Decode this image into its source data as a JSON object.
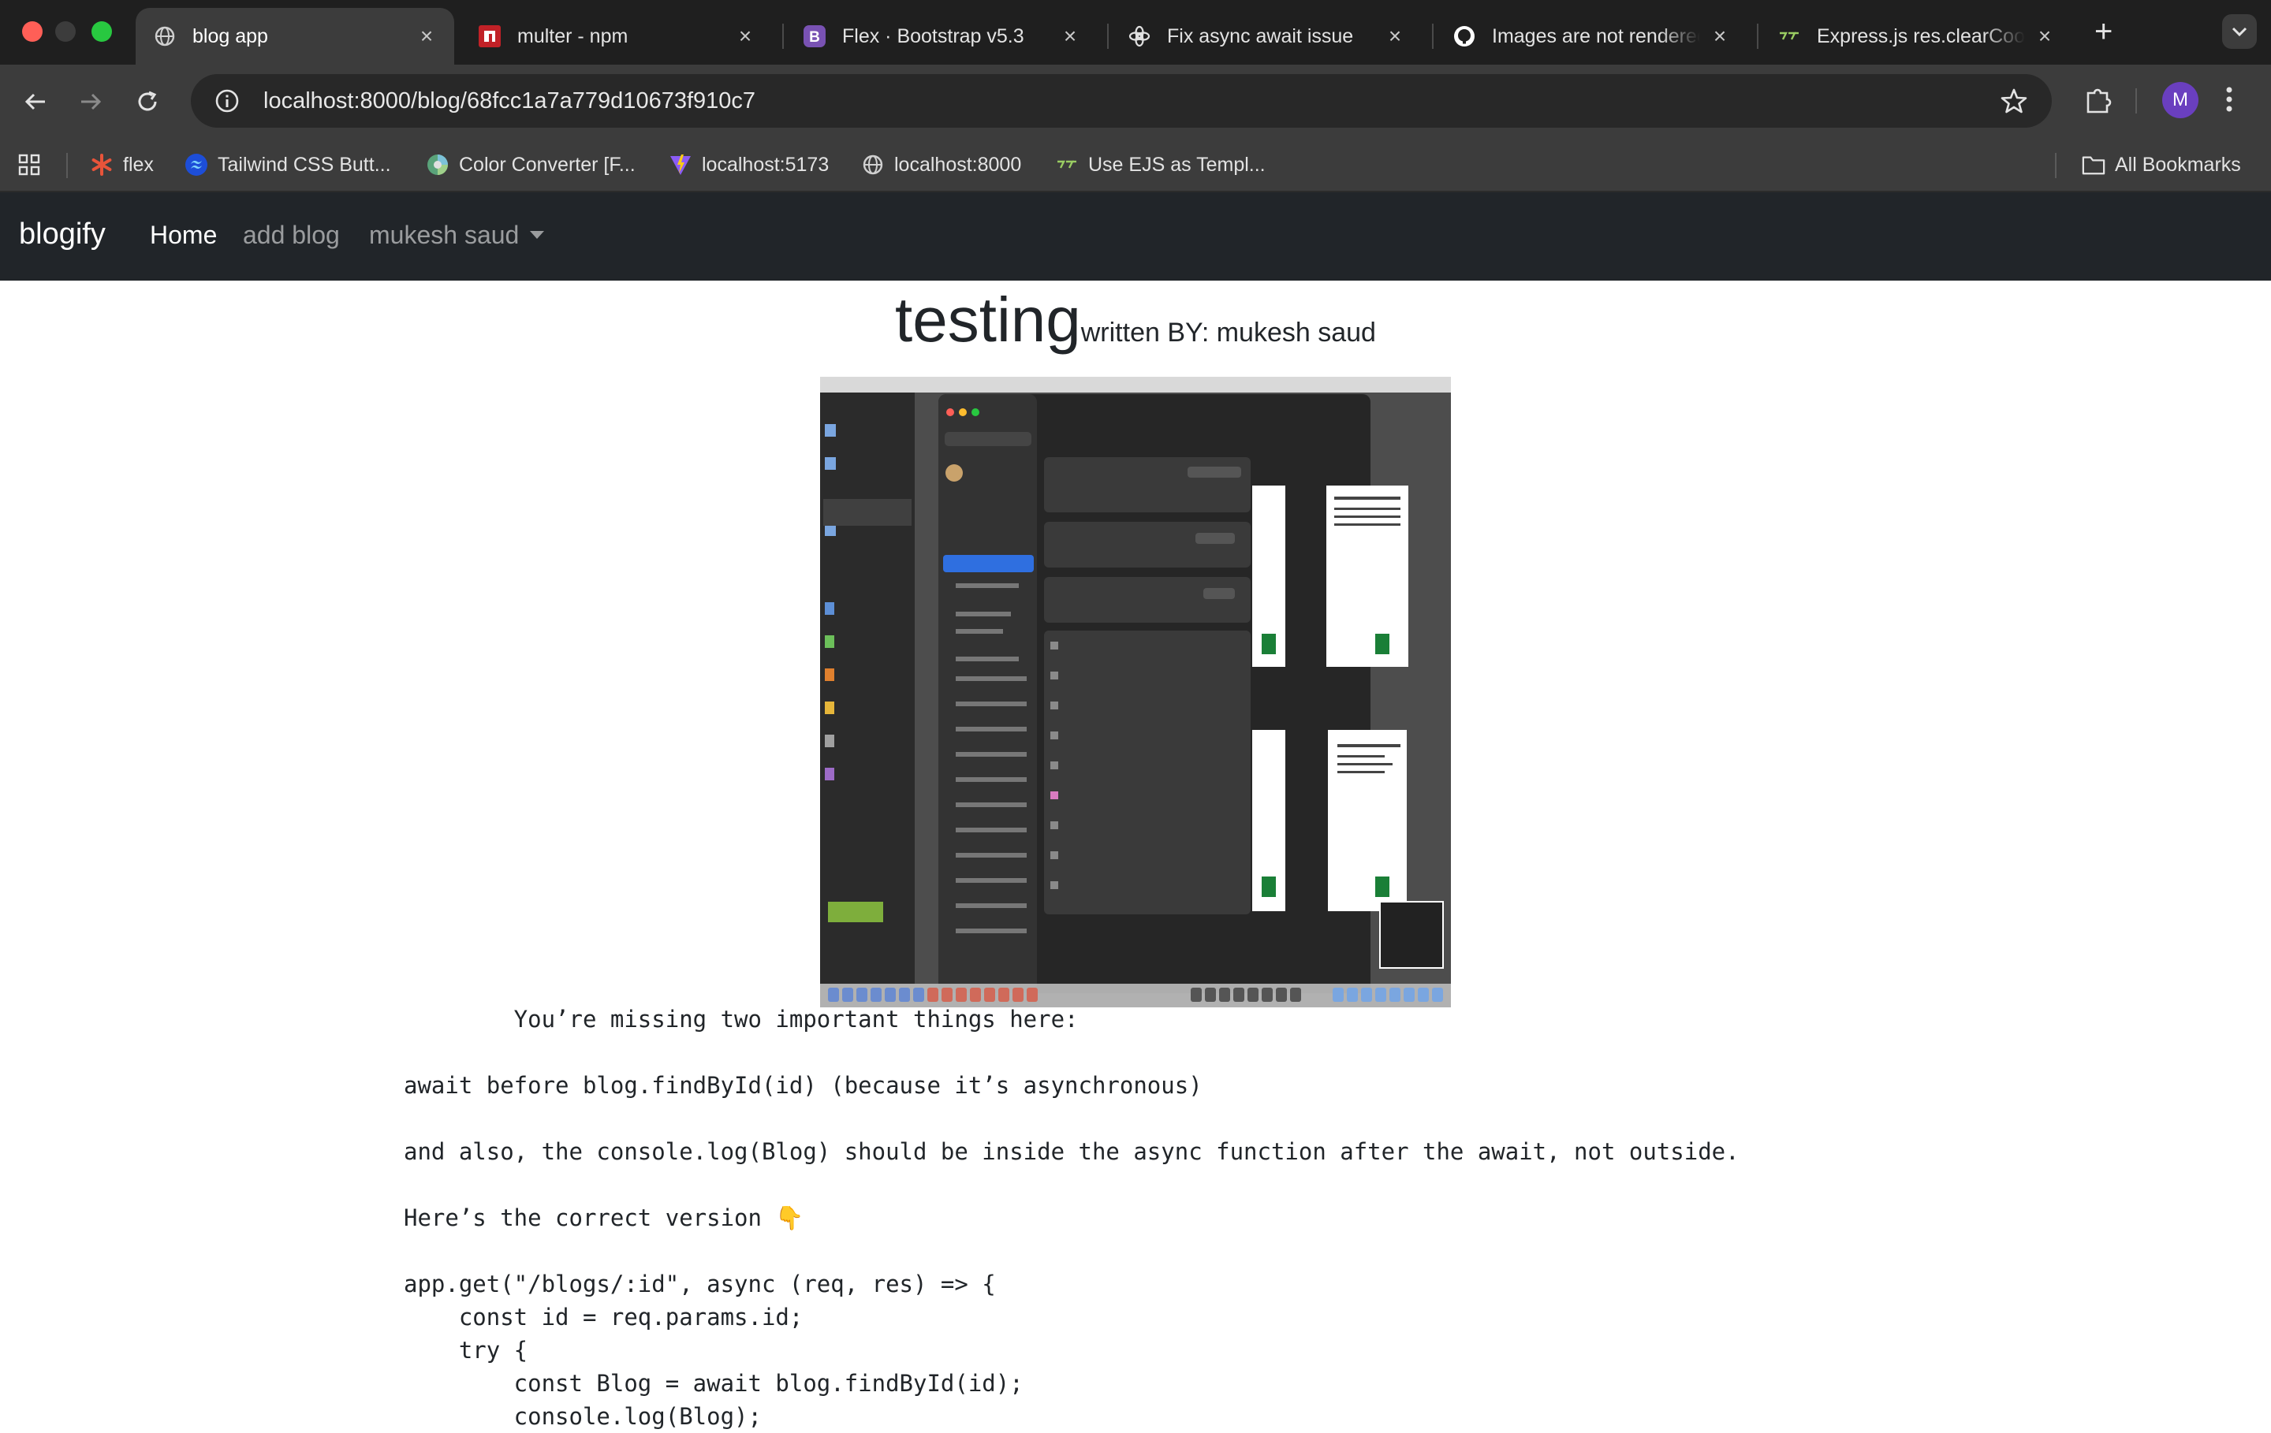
{
  "browser": {
    "tabs": [
      {
        "title": "blog app",
        "active": true,
        "icon": "globe-icon"
      },
      {
        "title": "multer - npm",
        "active": false,
        "icon": "npm-icon"
      },
      {
        "title": "Flex · Bootstrap v5.3",
        "active": false,
        "icon": "bootstrap-icon"
      },
      {
        "title": "Fix async await issue",
        "active": false,
        "icon": "openai-icon"
      },
      {
        "title": "Images are not rendered",
        "active": false,
        "icon": "github-icon"
      },
      {
        "title": "Express.js res.clearCookie",
        "active": false,
        "icon": "ejs-icon"
      }
    ],
    "url": "localhost:8000/blog/68fcc1a7a779d10673f910c7",
    "profile_initial": "M",
    "bookmarks": [
      {
        "label": "flex",
        "icon": "asterisk-icon"
      },
      {
        "label": "Tailwind CSS Butt...",
        "icon": "tailwind-icon"
      },
      {
        "label": "Color Converter [F...",
        "icon": "color-wheel-icon"
      },
      {
        "label": "localhost:5173",
        "icon": "vite-icon"
      },
      {
        "label": "localhost:8000",
        "icon": "globe-icon"
      },
      {
        "label": "Use EJS as Templ...",
        "icon": "ejs-icon"
      }
    ],
    "all_bookmarks_label": "All Bookmarks"
  },
  "site_nav": {
    "brand": "blogify",
    "links": [
      {
        "label": "Home",
        "active": true
      },
      {
        "label": "add blog",
        "active": false
      }
    ],
    "user_menu": "mukesh saud"
  },
  "post": {
    "title": "testing",
    "author_line": "written BY: mukesh saud",
    "image_alt": "screenshot of macOS System Settings Storage panel over LibreOffice Start Center",
    "body": "        You’re missing two important things here:\n\nawait before blog.findById(id) (because it’s asynchronous)\n\nand also, the console.log(Blog) should be inside the async function after the await, not outside.\n\nHere’s the correct version 👇\n\napp.get(\"/blogs/:id\", async (req, res) => {\n    const id = req.params.id;\n    try {\n        const Blog = await blog.findById(id);\n        console.log(Blog);"
  },
  "colors": {
    "tabstrip": "#1f1f1f",
    "toolbar": "#3c3c3c",
    "navbar": "#212529",
    "avatar": "#6a3fbf"
  }
}
